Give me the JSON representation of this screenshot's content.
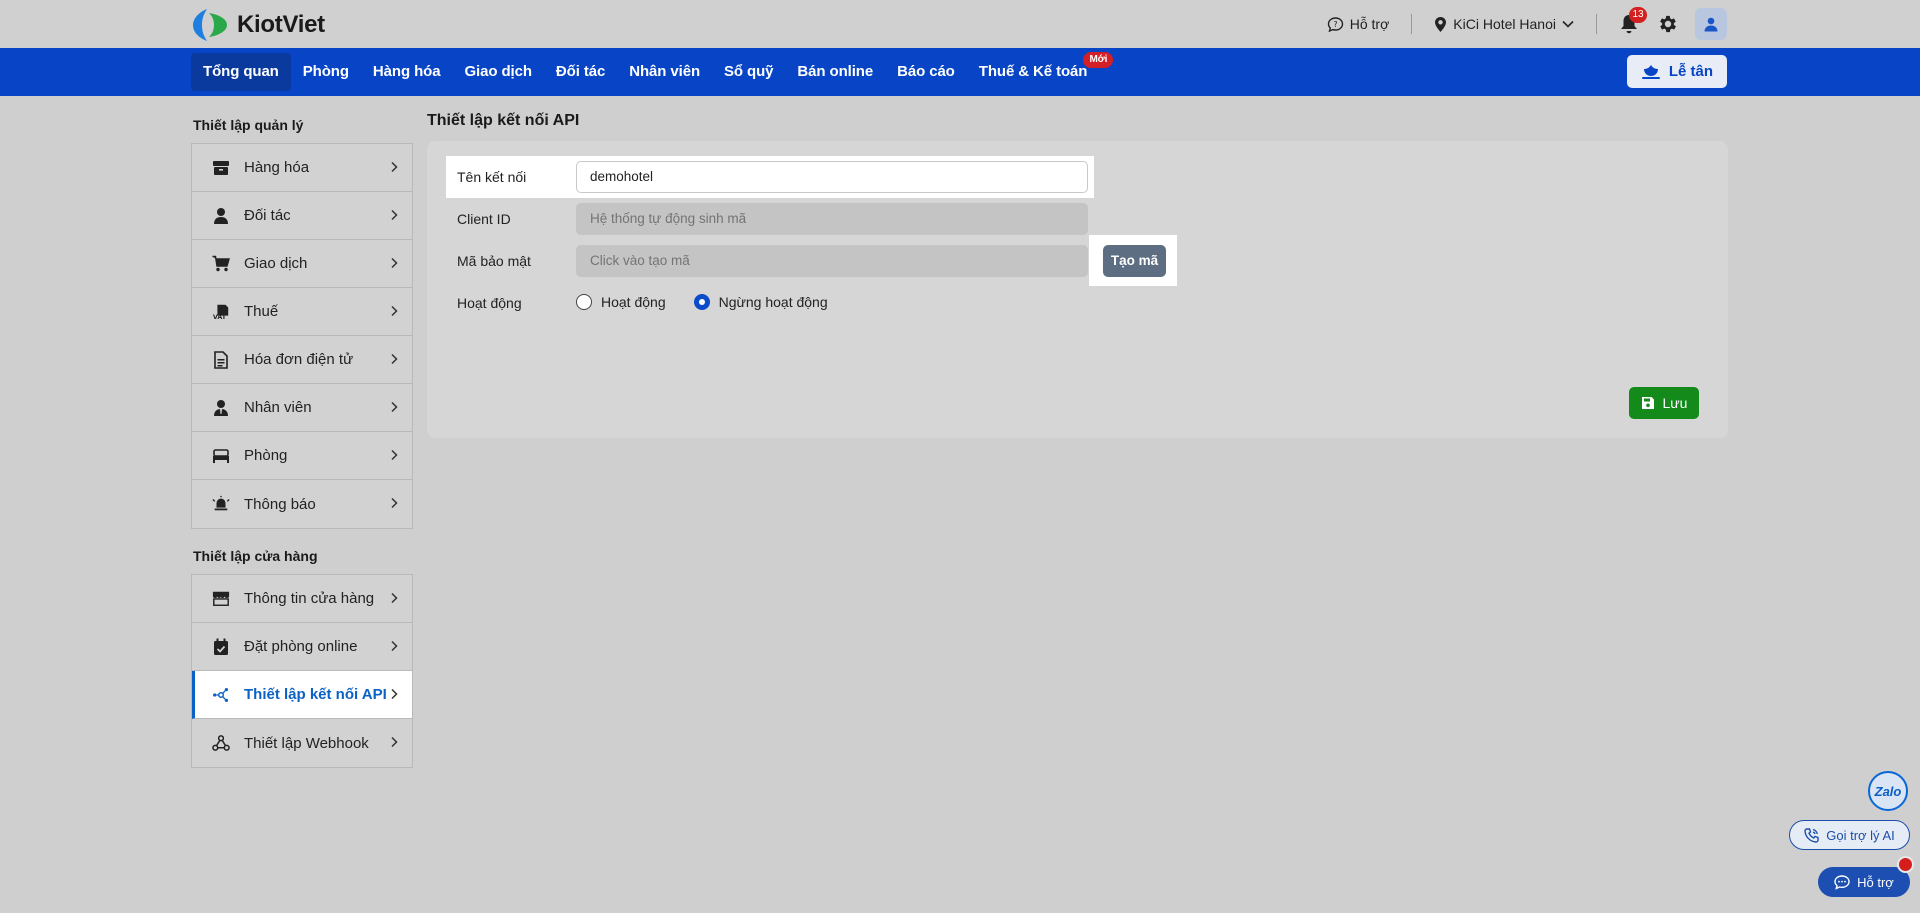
{
  "brand": {
    "name": "KiotViet"
  },
  "topbar": {
    "support_label": "Hỗ trợ",
    "branch_label": "KiCi Hotel Hanoi",
    "notification_count": "13"
  },
  "nav": {
    "items": [
      {
        "label": "Tổng quan"
      },
      {
        "label": "Phòng"
      },
      {
        "label": "Hàng hóa"
      },
      {
        "label": "Giao dịch"
      },
      {
        "label": "Đối tác"
      },
      {
        "label": "Nhân viên"
      },
      {
        "label": "Sổ quỹ"
      },
      {
        "label": "Bán online"
      },
      {
        "label": "Báo cáo"
      },
      {
        "label": "Thuế & Kế toán"
      }
    ],
    "new_badge": "Mới",
    "reception_label": "Lễ tân"
  },
  "sidebar": {
    "group1_title": "Thiết lập quản lý",
    "group1": [
      {
        "label": "Hàng hóa",
        "icon": "box-icon"
      },
      {
        "label": "Đối tác",
        "icon": "person-icon"
      },
      {
        "label": "Giao dịch",
        "icon": "cart-icon"
      },
      {
        "label": "Thuế",
        "icon": "vat-icon"
      },
      {
        "label": "Hóa đơn điện tử",
        "icon": "invoice-icon"
      },
      {
        "label": "Nhân viên",
        "icon": "employee-icon"
      },
      {
        "label": "Phòng",
        "icon": "bed-icon"
      },
      {
        "label": "Thông báo",
        "icon": "alarm-icon"
      }
    ],
    "group2_title": "Thiết lập cửa hàng",
    "group2": [
      {
        "label": "Thông tin cửa hàng",
        "icon": "store-icon"
      },
      {
        "label": "Đặt phòng online",
        "icon": "calendar-check-icon"
      },
      {
        "label": "Thiết lập kết nối API",
        "icon": "api-icon",
        "active": true
      },
      {
        "label": "Thiết lập Webhook",
        "icon": "webhook-icon"
      }
    ]
  },
  "main": {
    "title": "Thiết lập kết nối API",
    "fields": {
      "name_label": "Tên kết nối",
      "name_value": "demohotel",
      "client_label": "Client ID",
      "client_placeholder": "Hệ thống tự động sinh mã",
      "secret_label": "Mã bảo mật",
      "secret_placeholder": "Click vào tạo mã",
      "generate_label": "Tạo mã",
      "status_label": "Hoạt động",
      "status_options": [
        "Hoạt động",
        "Ngừng hoạt động"
      ],
      "status_selected": "Ngừng hoạt động"
    },
    "save_label": "Lưu"
  },
  "floating": {
    "zalo_label": "Zalo",
    "ai_label": "Gọi trợ lý AI",
    "help_label": "Hỗ trợ"
  },
  "colors": {
    "nav_bg": "#0845c6",
    "active_link": "#0b62c6",
    "save_green": "#138a1a",
    "badge_red": "#d41f26"
  }
}
